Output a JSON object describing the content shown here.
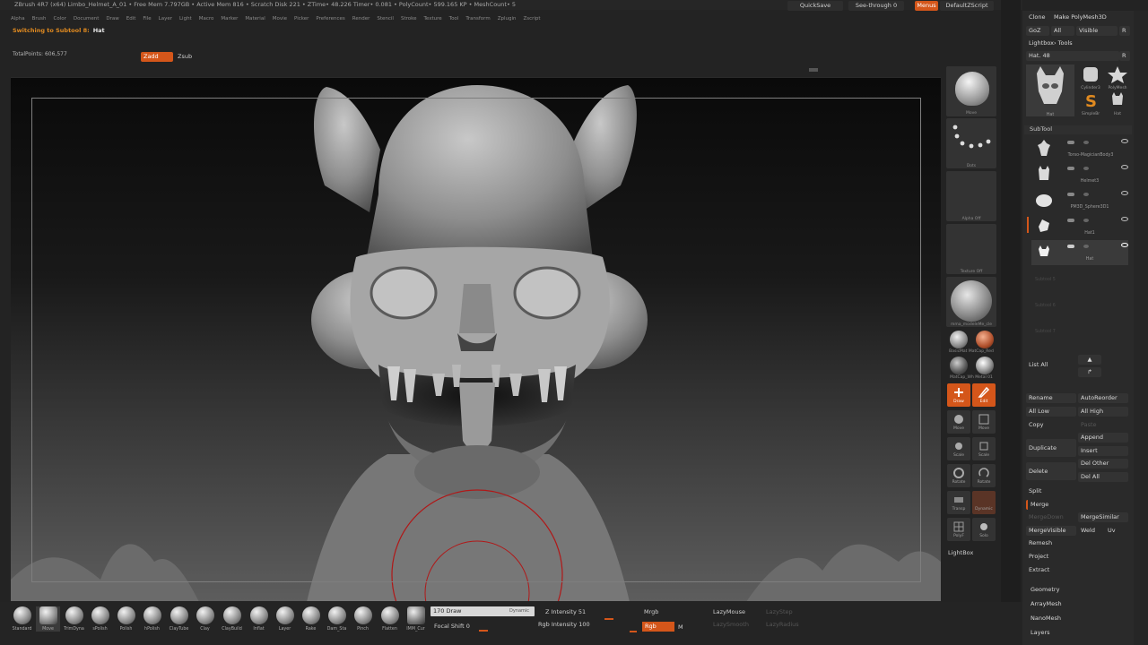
{
  "titlebar": {
    "text": "ZBrush 4R7 (x64)    Limbo_Helmet_A_01    • Free Mem 7.797GB • Active Mem 816 • Scratch Disk 221 • ZTime• 48.226 Timer• 0.081 • PolyCount• 599.165 KP • MeshCount• 5",
    "quicksave": "QuickSave",
    "see_through": "See-through 0",
    "menus_btn": "Menus",
    "script": "DefaultZScript"
  },
  "menubar": [
    "Alpha",
    "Brush",
    "Color",
    "Document",
    "Draw",
    "Edit",
    "File",
    "Layer",
    "Light",
    "Macro",
    "Marker",
    "Material",
    "Movie",
    "Picker",
    "Preferences",
    "Render",
    "Stencil",
    "Stroke",
    "Texture",
    "Tool",
    "Transform",
    "Zplugin",
    "Zscript"
  ],
  "status": {
    "message": "Switching to Subtool 8:",
    "subtool": "Hat",
    "total_points": "TotalPoints: 606,577"
  },
  "zbuttons": {
    "zadd": "Zadd",
    "zsub": "Zsub"
  },
  "shelf": {
    "move": "Move",
    "dots": "Dots",
    "alpha": "Alpha Off",
    "texture": "Texture Off",
    "material": "mma_modeleMe_cle",
    "mat1": "BasicMat",
    "mat2": "MatCap_Red",
    "mat3": "MatCap_Wh",
    "mat4": "Metal 01",
    "draw": "Draw",
    "edit": "Edit",
    "move_a": "Move",
    "move_b": "Move",
    "scale_a": "Scale",
    "scale_b": "Scale",
    "rotate_a": "Rotate",
    "rotate_b": "Rotate",
    "transp": "Transp",
    "dynamic": "Dynamic",
    "polyf": "PolyF",
    "solo": "Solo",
    "lightbox": "LightBox"
  },
  "panel": {
    "clone": "Clone",
    "make_polymesh": "Make PolyMesh3D",
    "goz": "GoZ",
    "all": "All",
    "visible": "Visible",
    "r": "R",
    "lightbox_tools": "Lightbox› Tools",
    "hat_value": "Hat. 48",
    "tool_cyl": "Cylinder3",
    "tool_poly": "PolyMesh",
    "tool_simple": "SimpleBr",
    "tool_hat": "Hat",
    "subtool_title": "SubTool",
    "subtools": [
      "Torso-MagicianBody3",
      "Helmet3",
      "PM3D_Sphere3D1",
      "Hat1",
      "Hat"
    ],
    "empty_slots": [
      "Subtool 5",
      "Subtool 6",
      "Subtool 7"
    ],
    "list_all": "List All",
    "rename": "Rename",
    "autoreorder": "AutoReorder",
    "all_low": "All Low",
    "all_high": "All High",
    "copy": "Copy",
    "paste": "Paste",
    "duplicate": "Duplicate",
    "append": "Append",
    "insert": "Insert",
    "delete": "Delete",
    "del_other": "Del Other",
    "del_all": "Del All",
    "split": "Split",
    "merge": "Merge",
    "merge_down": "MergeDown",
    "merge_similar": "MergeSimilar",
    "merge_visible": "MergeVisible",
    "weld": "Weld",
    "uv": "Uv",
    "remesh": "Remesh",
    "project": "Project",
    "extract": "Extract",
    "geometry": "Geometry",
    "arraymesh": "ArrayMesh",
    "nanomesh": "NanoMesh",
    "layers": "Layers"
  },
  "brushes": [
    "Standard",
    "Move",
    "TrimDyna",
    "sPolish",
    "Polish",
    "hPolish",
    "ClayTube",
    "Clay",
    "ClayBuild",
    "Inflat",
    "Layer",
    "Rake",
    "Dam_Sta",
    "Pinch",
    "Flatten",
    "IMM_Cur"
  ],
  "bottom": {
    "draw_size": "170 Draw",
    "dynamic": "Dynamic",
    "focal_shift": "Focal Shift 0",
    "z_intensity": "Z Intensity 51",
    "rgb_intensity": "Rgb Intensity 100",
    "mrgb": "Mrgb",
    "rgb": "Rgb",
    "m": "M",
    "lazymouse": "LazyMouse",
    "lazystep": "LazyStep",
    "lazysmooth": "LazySmooth",
    "lazyradius": "LazyRadius"
  }
}
